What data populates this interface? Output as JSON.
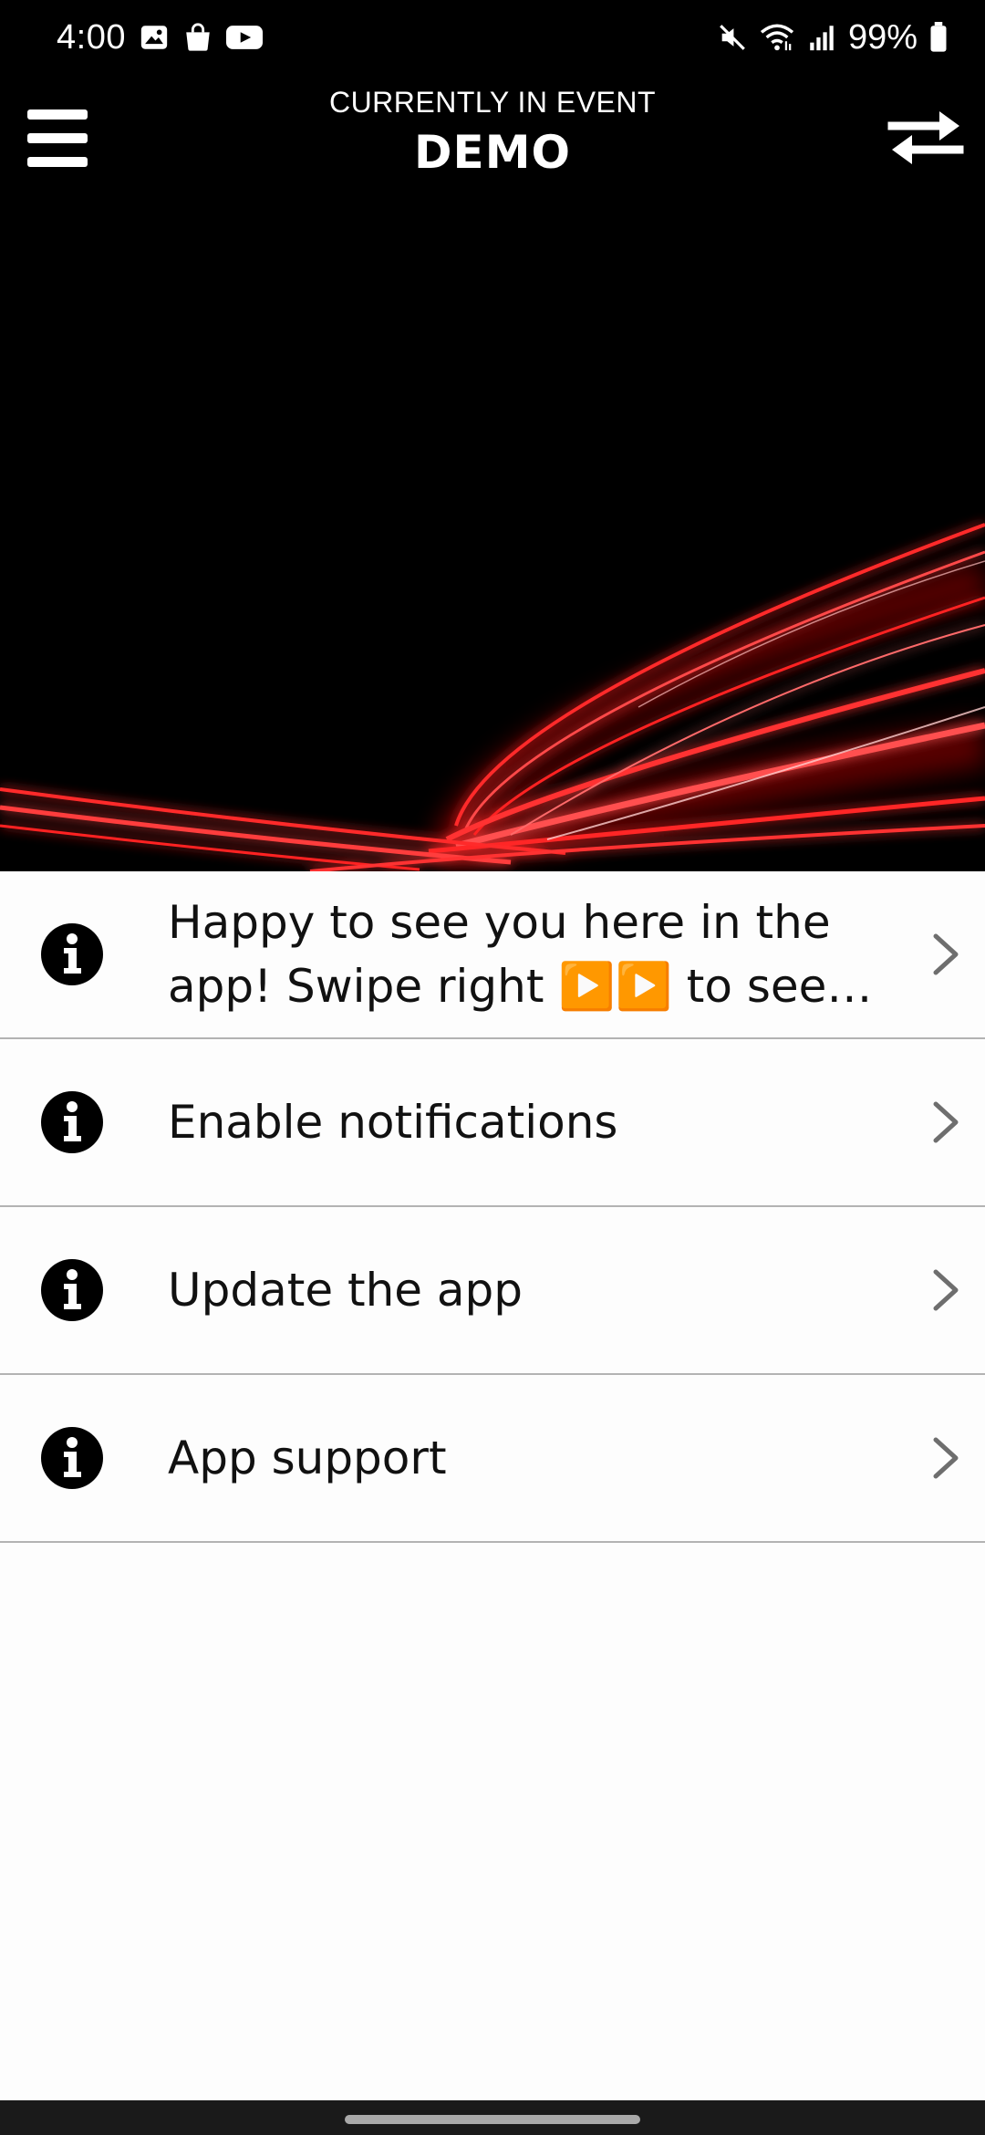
{
  "status_bar": {
    "time": "4:00",
    "battery": "99%",
    "left_icons": [
      "gallery-icon",
      "shopping-bag-icon",
      "youtube-icon"
    ],
    "right_icons": [
      "mute-icon",
      "wifi-icon",
      "signal-icon",
      "battery-icon"
    ]
  },
  "header": {
    "subtitle": "CURRENTLY IN EVENT",
    "title": "DEMO",
    "menu_icon": "hamburger-menu-icon",
    "switch_icon": "swap-arrows-icon"
  },
  "banner": {
    "background": "#000000",
    "accent": "#ff1a1a"
  },
  "list": {
    "items": [
      {
        "label": "Happy to see you here in the app! Swipe right ▶️▶️ to see t...",
        "icon": "info-icon"
      },
      {
        "label": "Enable notifications",
        "icon": "info-icon"
      },
      {
        "label": "Update the app",
        "icon": "info-icon"
      },
      {
        "label": "App support",
        "icon": "info-icon"
      }
    ]
  },
  "colors": {
    "header_bg": "#000000",
    "list_bg": "#fdfdfd",
    "divider": "#b3b3b3",
    "chevron": "#6e6e6e",
    "text": "#111111"
  }
}
